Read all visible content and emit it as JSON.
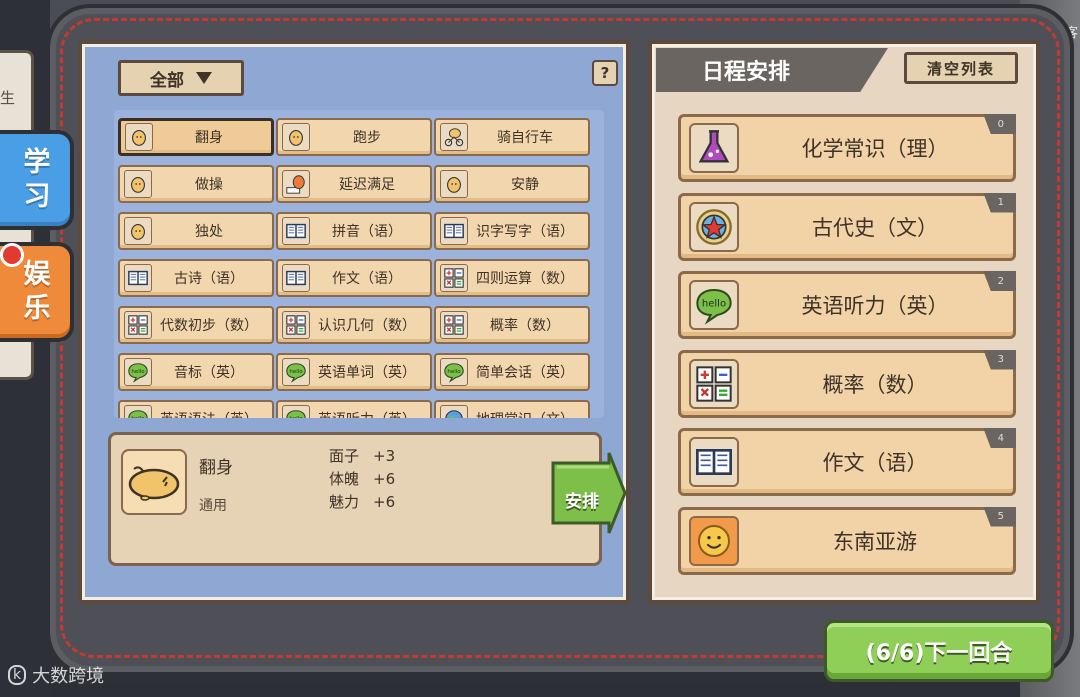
{
  "side_tabs": [
    {
      "label": "学习"
    },
    {
      "label": "娱乐"
    }
  ],
  "left_wall_text": "生",
  "right_edge_text": "客",
  "filter": {
    "label": "全部"
  },
  "help_label": "?",
  "activities": [
    {
      "label": "翻身",
      "icon": "potato-lying-icon",
      "selected": true
    },
    {
      "label": "跑步",
      "icon": "potato-running-icon"
    },
    {
      "label": "骑自行车",
      "icon": "bicycle-icon"
    },
    {
      "label": "做操",
      "icon": "exercise-icon"
    },
    {
      "label": "延迟满足",
      "icon": "delayed-gratification-icon"
    },
    {
      "label": "安静",
      "icon": "quiet-icon"
    },
    {
      "label": "独处",
      "icon": "alone-icon"
    },
    {
      "label": "拼音（语）",
      "icon": "book-icon"
    },
    {
      "label": "识字写字（语）",
      "icon": "book-icon"
    },
    {
      "label": "古诗（语）",
      "icon": "book-icon"
    },
    {
      "label": "作文（语）",
      "icon": "book-icon"
    },
    {
      "label": "四则运算（数）",
      "icon": "math-icon"
    },
    {
      "label": "代数初步（数）",
      "icon": "math-icon"
    },
    {
      "label": "认识几何（数）",
      "icon": "math-icon"
    },
    {
      "label": "概率（数）",
      "icon": "math-icon"
    },
    {
      "label": "音标（英）",
      "icon": "hello-bubble-icon"
    },
    {
      "label": "英语单词（英）",
      "icon": "hello-bubble-icon"
    },
    {
      "label": "简单会话（英）",
      "icon": "hello-bubble-icon"
    },
    {
      "label": "英语语法（英）",
      "icon": "hello-bubble-icon"
    },
    {
      "label": "英语听力（英）",
      "icon": "hello-bubble-icon"
    },
    {
      "label": "地理常识（文）",
      "icon": "globe-icon"
    }
  ],
  "detail": {
    "name": "翻身",
    "type": "通用",
    "stats": [
      {
        "label": "面子",
        "value": "+3"
      },
      {
        "label": "体魄",
        "value": "+6"
      },
      {
        "label": "魅力",
        "value": "+6"
      }
    ],
    "arrange_label": "安排"
  },
  "schedule": {
    "title": "日程安排",
    "clear_label": "清空列表",
    "items": [
      {
        "index": "0",
        "label": "化学常识（理）",
        "icon": "flask-icon"
      },
      {
        "index": "1",
        "label": "古代史（文）",
        "icon": "star-medal-icon"
      },
      {
        "index": "2",
        "label": "英语听力（英）",
        "icon": "hello-bubble-icon"
      },
      {
        "index": "3",
        "label": "概率（数）",
        "icon": "math-icon"
      },
      {
        "index": "4",
        "label": "作文（语）",
        "icon": "book-icon"
      },
      {
        "index": "5",
        "label": "东南亚游",
        "icon": "smiley-icon"
      }
    ]
  },
  "next_round_label": "(6/6)下一回合",
  "watermark": "大数跨境",
  "colors": {
    "left_panel_bg": "#8ea7d3",
    "cell_bg": "#f2d6ad",
    "next_button": "#8fcf58",
    "study_tab": "#4a9ee6",
    "fun_tab": "#ef8a3a",
    "stitch_red": "#c23a32"
  }
}
